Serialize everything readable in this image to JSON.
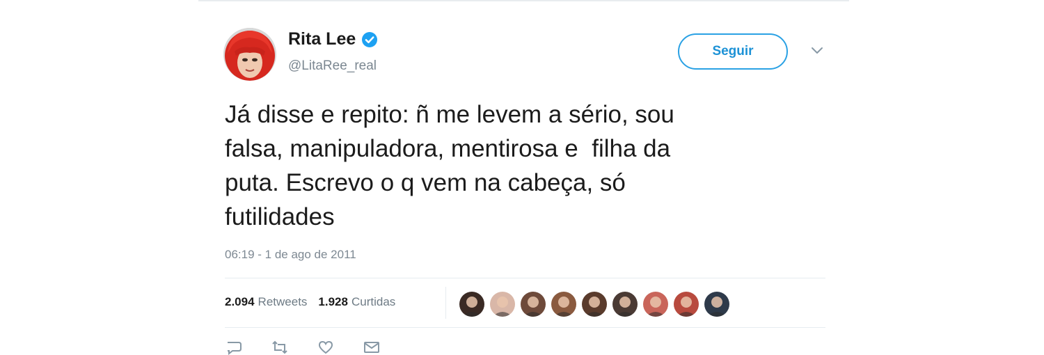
{
  "author": {
    "display_name": "Rita Lee",
    "handle": "@LitaRee_real",
    "avatar_icon": "profile-photo-red-hair",
    "verified_icon": "verified-badge-icon"
  },
  "follow_button": {
    "label": "Seguir"
  },
  "menu_icon": "chevron-down-icon",
  "tweet": {
    "lines": [
      "Já disse e repito: ñ me levem a sério, sou",
      "falsa, manipuladora, mentirosa e  filha da",
      "puta. Escrevo o q vem na cabeça, só",
      "futilidades"
    ],
    "timestamp": "06:19 - 1 de ago de 2011"
  },
  "stats": {
    "retweets_count": "2.094",
    "retweets_label": "Retweets",
    "likes_count": "1.928",
    "likes_label": "Curtidas"
  },
  "liker_avatars": [
    {
      "name": "liker-avatar-1",
      "color": "#3a2a24"
    },
    {
      "name": "liker-avatar-2",
      "color": "#d9b7a8"
    },
    {
      "name": "liker-avatar-3",
      "color": "#6e4a3a"
    },
    {
      "name": "liker-avatar-4",
      "color": "#8a5a3f"
    },
    {
      "name": "liker-avatar-5",
      "color": "#5a3b2c"
    },
    {
      "name": "liker-avatar-6",
      "color": "#4a3a34"
    },
    {
      "name": "liker-avatar-7",
      "color": "#c9655a"
    },
    {
      "name": "liker-avatar-8",
      "color": "#b84a3e"
    },
    {
      "name": "liker-avatar-9",
      "color": "#2e3a4a"
    }
  ],
  "action_icons": [
    "reply-icon",
    "retweet-icon",
    "like-icon",
    "message-icon"
  ],
  "colors": {
    "accent": "#1da1f2",
    "follow_border": "#2aa1e4",
    "muted_text": "#7b8791",
    "divider": "#e6ecf0"
  }
}
